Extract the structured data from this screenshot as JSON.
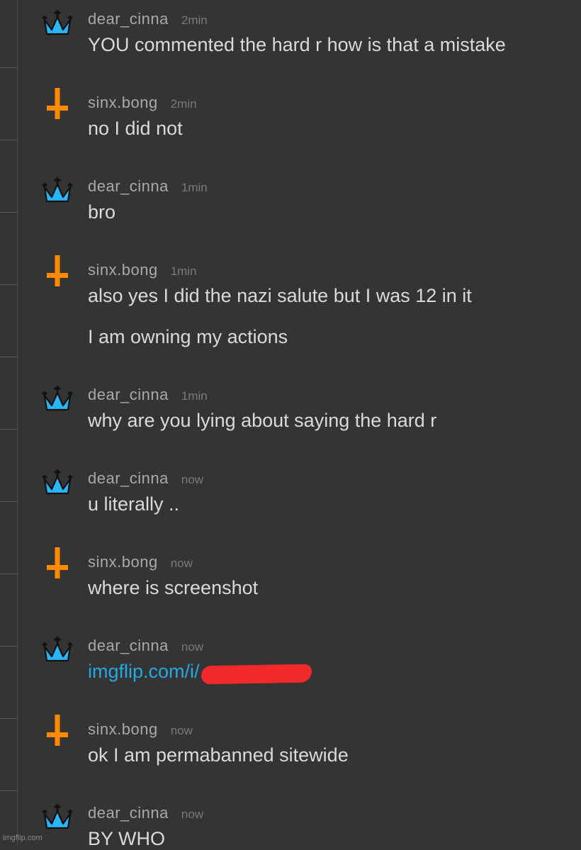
{
  "messages": [
    {
      "user": "dear_cinna",
      "avatar": "crown-icon",
      "time": "2min",
      "lines": [
        "YOU commented the hard r how is that a mistake"
      ]
    },
    {
      "user": "sinx.bong",
      "avatar": "inverted-cross-icon",
      "time": "2min",
      "lines": [
        "no I did not"
      ]
    },
    {
      "user": "dear_cinna",
      "avatar": "crown-icon",
      "time": "1min",
      "lines": [
        "bro"
      ]
    },
    {
      "user": "sinx.bong",
      "avatar": "inverted-cross-icon",
      "time": "1min",
      "lines": [
        "also yes I did the nazi salute but I was 12 in it",
        "I am owning my actions"
      ]
    },
    {
      "user": "dear_cinna",
      "avatar": "crown-icon",
      "time": "1min",
      "lines": [
        "why are you lying about saying the hard r"
      ]
    },
    {
      "user": "dear_cinna",
      "avatar": "crown-icon",
      "time": "now",
      "lines": [
        "u literally .."
      ]
    },
    {
      "user": "sinx.bong",
      "avatar": "inverted-cross-icon",
      "time": "now",
      "lines": [
        "where is screenshot"
      ]
    },
    {
      "user": "dear_cinna",
      "avatar": "crown-icon",
      "time": "now",
      "link": "imgflip.com/i/"
    },
    {
      "user": "sinx.bong",
      "avatar": "inverted-cross-icon",
      "time": "now",
      "lines": [
        "ok I am permabanned sitewide"
      ]
    },
    {
      "user": "dear_cinna",
      "avatar": "crown-icon",
      "time": "now",
      "lines": [
        "BY WHO"
      ]
    }
  ],
  "watermark": "imgflip.com",
  "colors": {
    "background": "#343434",
    "username": "#a9a9a9",
    "timestamp": "#7a7a7a",
    "text": "#dadada",
    "link": "#26a8e6",
    "crown": "#29b6f6",
    "cross": "#ff8a00",
    "redaction": "#f22a2a"
  }
}
